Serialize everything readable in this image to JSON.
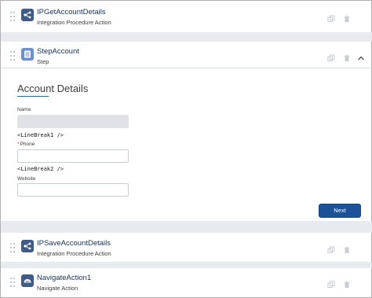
{
  "elements": [
    {
      "title": "IPGetAccountDetails",
      "subtitle": "Integration Procedure Action",
      "icon": "integration-procedure-icon",
      "icon_color": "#3f5b8a"
    },
    {
      "title": "StepAccount",
      "subtitle": "Step",
      "icon": "step-icon",
      "icon_color": "#6b8fd6"
    },
    {
      "title": "IPSaveAccountDetails",
      "subtitle": "Integration Procedure Action",
      "icon": "integration-procedure-icon",
      "icon_color": "#3f5b8a"
    },
    {
      "title": "NavigateAction1",
      "subtitle": "Navigate Action",
      "icon": "navigate-icon",
      "icon_color": "#3f5b8a"
    }
  ],
  "step": {
    "form_title": "Account Details",
    "fields": [
      {
        "label": "Name",
        "required": false,
        "value": "",
        "disabled": true
      },
      {
        "label": "Phone",
        "required": true,
        "required_marker": "*",
        "value": "",
        "disabled": false
      },
      {
        "label": "Website",
        "required": false,
        "value": "",
        "disabled": false
      }
    ],
    "line_breaks": [
      "<LineBreak1 />",
      "<LineBreak2 />"
    ],
    "next_label": "Next"
  },
  "colors": {
    "accent": "#0070d2",
    "button": "#1b5297",
    "band": "#e8ebee",
    "required": "#c23934"
  }
}
